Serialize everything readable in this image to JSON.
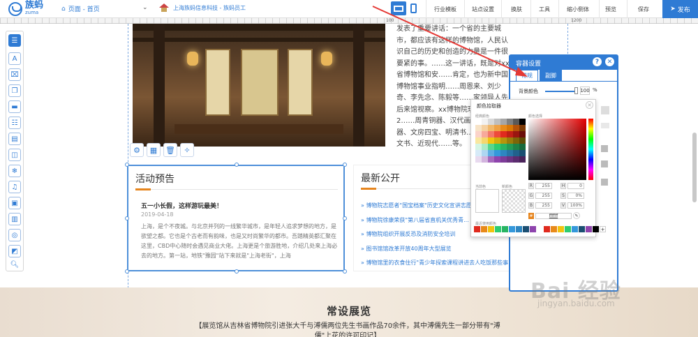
{
  "topbar": {
    "logo_text": "族蚂",
    "logo_sub": "zuma",
    "page_label": "页面 - 首页",
    "company": "上海族蚂信息科技 - 族蚂员工",
    "menu": [
      "行业模板",
      "站点设置",
      "换肤",
      "工具",
      "缩小侧体",
      "预览",
      "保存"
    ],
    "publish": "发布"
  },
  "ruler": {
    "marks": [
      "100",
      "1200"
    ]
  },
  "article": {
    "text": "发表了重要讲话：一个省的主要城市，都应该有这样的博物馆，人民认识自己的历史和创造的力量是一件很要紧的事。……这一讲话，既是对xx省博物馆和安……肯定，也为新中国博物馆事业指明……周恩来、刘少奇、李先念、陈毅等……家领导人先后来馆视察。xx博物院现藏文物近2……周青铜器、汉代画像石……器、文房四宝、明清书……本、契约文书、近现代……等。"
  },
  "event_box": {
    "title": "活动预告",
    "item_title": "五一小长假，这样游玩最美！",
    "date": "2019-04-18",
    "body": "上海，是个不夜城。与北京并列的一线繁华城市，是年轻人追求梦想的地方，是欲望之都。它也是个古老而有韵味，也是又时尚繁华的都市。吾踏精英都汇聚在这里，CBD中心随时会遇见商业大佬。上海更是个旅游胜地，介绍几处来上海必去的地方。第一站，地铁\"豫园\"站下来就是\"上海老街\"，上海"
  },
  "news_box": {
    "title": "最新公开",
    "items": [
      "博物院志愿者\"国宝档案\"历史文化宣讲志愿...",
      "博物院徐康荣获\"第八届省直机关优秀青...",
      "博物院组织开展反恐及消防安全培训",
      "图书馆馆改革开放40周年大型展览",
      "博物馆里的衣食住行\"青少年探索课程讲进去人吃饭那些事"
    ]
  },
  "bottom": {
    "title": "常设展览",
    "text": "【展览馆从吉林省博物院引进张大千与溥儒两位先生书画作品70余件，其中溥儒先生一部分带有\"溥儒\"上花的许可印记】"
  },
  "panel": {
    "title": "容器设置",
    "tab_general": "常规",
    "tab_footer": "副脚",
    "bg_label": "背景颜色",
    "opacity_value": "100",
    "percent": "%"
  },
  "picker": {
    "title": "颜色拾取器",
    "classic_label": "经典颜色",
    "choice_label": "颜色选择",
    "current_label": "当前色",
    "new_label": "新颜色",
    "recent_label": "最近使用颜色",
    "classic_colors": [
      "#ffffff",
      "#f2f2f2",
      "#d9d9d9",
      "#bfbfbf",
      "#a6a6a6",
      "#808080",
      "#595959",
      "#000000",
      "#f7e3c7",
      "#f5d0a0",
      "#f1b86b",
      "#eea246",
      "#e88a1a",
      "#d97706",
      "#b45309",
      "#7c3a06",
      "#fbd3c9",
      "#f7a99b",
      "#f2786a",
      "#ee4b3b",
      "#e02a1e",
      "#c01f16",
      "#9a1610",
      "#6b0f0a",
      "#f9e79f",
      "#f5d76e",
      "#f1c40f",
      "#d4ac0d",
      "#b7950b",
      "#9a7d0a",
      "#7d6608",
      "#5e4d06",
      "#d5f5e3",
      "#abebc6",
      "#58d68d",
      "#2ecc71",
      "#28b463",
      "#239b56",
      "#1d8348",
      "#186a3b",
      "#d6eaf8",
      "#aed6f1",
      "#5dade2",
      "#3498db",
      "#2e86c1",
      "#2874a6",
      "#21618c",
      "#1b4f72",
      "#e8daef",
      "#d2b4de",
      "#a569bd",
      "#8e44ad",
      "#7d3c98",
      "#6c3483",
      "#5b2c6f",
      "#4a235a"
    ],
    "r": "255",
    "g": "255",
    "b": "255",
    "h": "0",
    "s": "0%",
    "v": "100%",
    "hex": "ffffff",
    "recent_colors": [
      "#e02a1e",
      "#e88a1a",
      "#f1c40f",
      "#2ecc71",
      "#28b463",
      "#3498db",
      "#2e86c1",
      "#1b4f72",
      "#8e44ad",
      "#ffffff",
      "#e02a1e",
      "#e88a1a",
      "#f1c40f",
      "#2ecc71",
      "#3498db",
      "#1b4f72",
      "#8e44ad",
      "#000000"
    ]
  },
  "watermark": {
    "big": "Bai 经验",
    "small": "jingyan.baidu.com"
  },
  "colors": {
    "accent": "#2f7bd4",
    "orange": "#e6851e",
    "arrow": "#e53935"
  }
}
